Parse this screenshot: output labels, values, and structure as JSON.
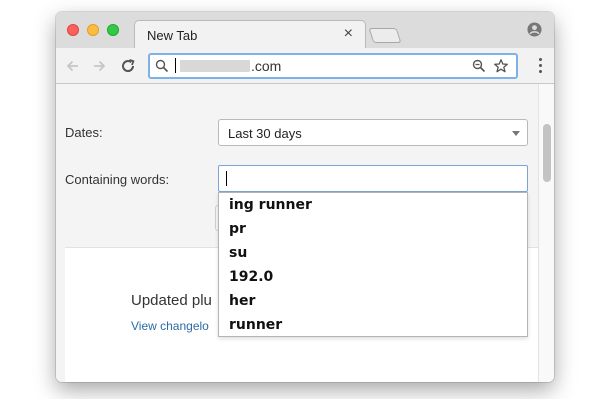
{
  "browser": {
    "tab": {
      "title": "New Tab",
      "close_label": "×"
    },
    "address_bar": {
      "domain_suffix": ".com"
    }
  },
  "form": {
    "dates_label": "Dates:",
    "dates_value": "Last 30 days",
    "words_label": "Containing words:",
    "words_value": ""
  },
  "autocomplete": {
    "suggestions": [
      "ing runner",
      "pr",
      "su",
      "192.0",
      "her",
      "runner"
    ]
  },
  "card": {
    "text_visible": "Updated plu",
    "link_visible": "View changelo"
  },
  "icons": {
    "back": "arrow-left-icon",
    "forward": "arrow-right-icon",
    "reload": "reload-icon",
    "search": "search-icon",
    "zoom": "zoom-icon",
    "star": "star-icon",
    "menu": "three-dots-icon",
    "profile": "profile-icon"
  },
  "colors": {
    "accent_focus": "#7fb1e9",
    "link": "#2b6ca3"
  }
}
